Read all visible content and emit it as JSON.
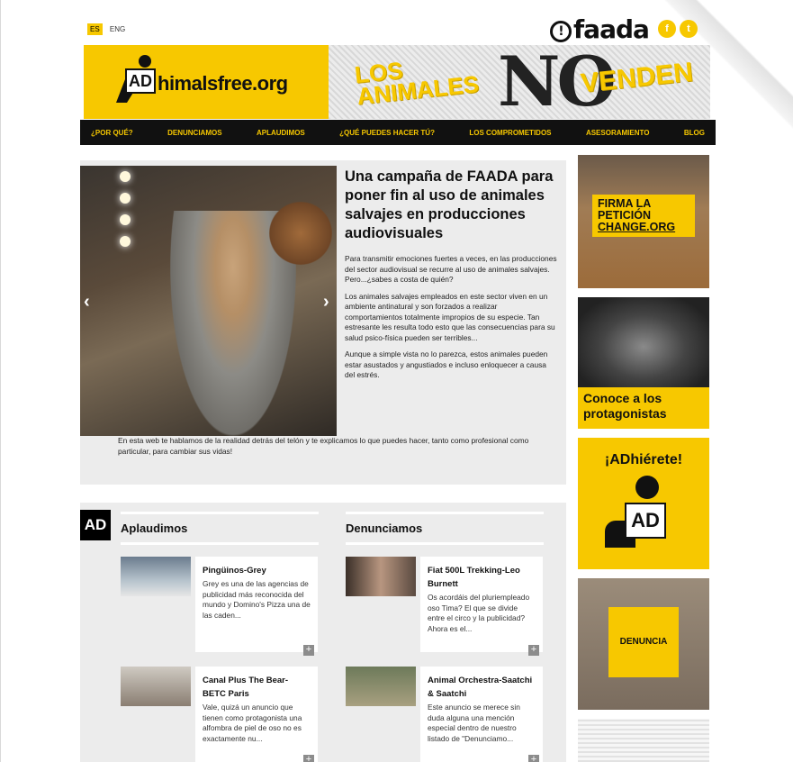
{
  "topbar": {
    "lang_es": "ES",
    "lang_eng": "ENG"
  },
  "brand": {
    "faada": "faada",
    "social_f": "f",
    "social_t": "t"
  },
  "header": {
    "logo_badge": "AD",
    "logo_text": "himalsfree.org",
    "banner_line1": "LOS",
    "banner_line2": "ANIMALES",
    "banner_no": "NO",
    "banner_line3": "VENDEN"
  },
  "nav": {
    "items": [
      "¿POR QUÉ?",
      "DENUNCIAMOS",
      "APLAUDIMOS",
      "¿QUÉ PUEDES HACER TÚ?",
      "LOS COMPROMETIDOS",
      "ASESORAMIENTO",
      "BLOG"
    ]
  },
  "feature": {
    "title": "Una campaña de FAADA para poner fin al uso de animales salvajes en producciones audiovisuales",
    "p1": "Para transmitir emociones fuertes a veces, en las producciones del sector audiovisual se recurre al uso de animales salvajes. Pero...¿sabes a costa de quién?",
    "p2": "Los animales salvajes empleados en este sector viven en un ambiente antinatural y son forzados a realizar comportamientos totalmente impropios de su especie. Tan estresante les resulta todo esto que las consecuencias para su salud psico-física pueden ser terribles...",
    "p3": "Aunque a simple vista no lo parezca, estos animales pueden estar asustados y angustiados e incluso enloquecer a causa del estrés.",
    "p4": "En esta web te hablamos de la realidad detrás del telón y te explicamos lo que puedes hacer, tanto como profesional como particular, para cambiar sus vidas!",
    "prev": "‹",
    "next": "›"
  },
  "lower": {
    "ad_tag": "AD",
    "left_title": "Aplaudimos",
    "right_title": "Denunciamos",
    "cards": [
      {
        "title": "Pingüinos-Grey",
        "text": "Grey es una de las agencias de publicidad más reconocida del mundo y Domino's Pizza una de las caden..."
      },
      {
        "title": "Canal Plus The Bear-BETC Paris",
        "text": "Vale, quizá un anuncio que tienen como protagonista una alfombra de piel de oso no es exactamente nu..."
      },
      {
        "title": "Fiat 500L Trekking-Leo Burnett",
        "text": "Os acordáis del pluriempleado oso Tima? El que se divide entre el circo y la publicidad? Ahora es el..."
      },
      {
        "title": "Animal Orchestra-Saatchi & Saatchi",
        "text": "Este anuncio se merece sin duda alguna una mención especial dentro de nuestro listado de \"Denunciamo..."
      }
    ],
    "plus": "+"
  },
  "sidebar": {
    "petition": {
      "line1": "FIRMA LA",
      "line2": "PETICIÓN",
      "line3": "CHANGE.ORG"
    },
    "protagonistas": "Conoce a los protagonistas",
    "adhierete": "¡ADhiérete!",
    "adhierete_badge": "AD",
    "denuncia": "DENUNCIA"
  },
  "colors": {
    "accent": "#f7c800",
    "dark": "#111111",
    "panel": "#ececec"
  }
}
